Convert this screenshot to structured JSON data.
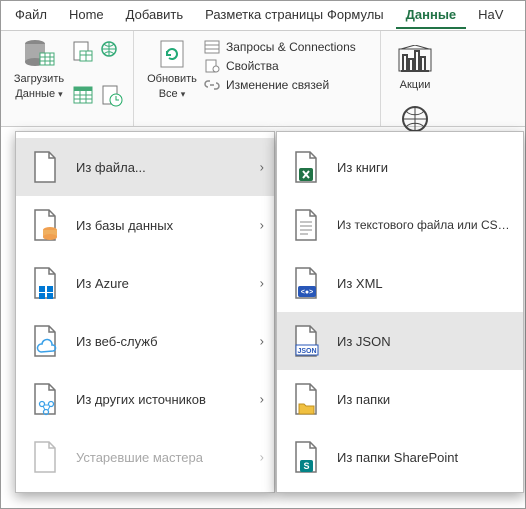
{
  "tabs": {
    "file": "Файл",
    "home": "Home",
    "insert": "Добавить",
    "layout": "Разметка страницы",
    "formulas": "Формулы",
    "data": "Данные",
    "view_cut": "НаV"
  },
  "ribbon": {
    "get_data_line1": "Загрузить",
    "get_data_line2": "Данные",
    "refresh_line1": "Обновить",
    "refresh_line2": "Все",
    "queries": "Запросы & Connections",
    "properties": "Свойства",
    "edit_links": "Изменение связей",
    "stocks": "Акции",
    "geo_cut": "Geo"
  },
  "menu1": {
    "from_file": "Из файла...",
    "from_db": "Из базы данных",
    "from_azure": "Из Azure",
    "from_web": "Из веб-служб",
    "from_other": "Из других источников",
    "legacy": "Устаревшие мастера"
  },
  "menu2": {
    "from_workbook": "Из книги",
    "from_text_csv": "Из текстового файла или CSV-файла",
    "from_xml": "Из XML",
    "from_json": "Из JSON",
    "from_folder": "Из папки",
    "from_sharepoint": "Из папки SharePoint",
    "json_badge": "JSON"
  },
  "colors": {
    "excel_green": "#217346",
    "hover_gray": "#e6e6e6"
  }
}
